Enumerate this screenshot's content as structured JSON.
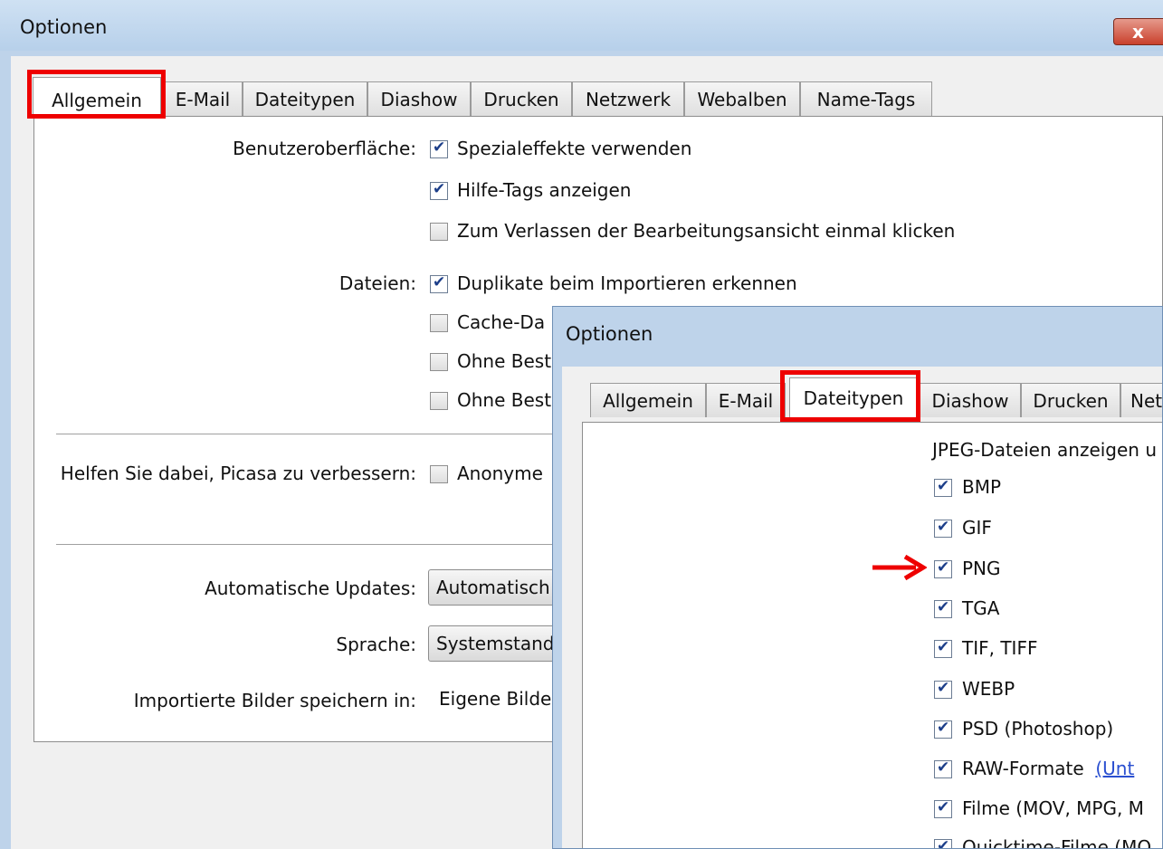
{
  "main": {
    "title": "Optionen",
    "close_glyph": "x",
    "tabs": [
      "Allgemein",
      "E-Mail",
      "Dateitypen",
      "Diashow",
      "Drucken",
      "Netzwerk",
      "Webalben",
      "Name-Tags"
    ],
    "active_tab": "Allgemein",
    "ui_label": "Benutzeroberfläche:",
    "ui_options": [
      {
        "label": "Spezialeffekte verwenden",
        "checked": true
      },
      {
        "label": "Hilfe-Tags anzeigen",
        "checked": true
      },
      {
        "label": "Zum Verlassen der Bearbeitungsansicht einmal klicken",
        "checked": false
      }
    ],
    "files_label": "Dateien:",
    "files_options": [
      {
        "label": "Duplikate beim Importieren erkennen",
        "checked": true
      },
      {
        "label": "Cache-Da",
        "checked": false
      },
      {
        "label": "Ohne Best",
        "checked": false
      },
      {
        "label": "Ohne Best",
        "checked": false
      }
    ],
    "help_label": "Helfen Sie dabei, Picasa zu verbessern:",
    "help_option": {
      "label": "Anonyme",
      "checked": false
    },
    "updates_label": "Automatische Updates:",
    "updates_value": "Automatisch",
    "language_label": "Sprache:",
    "language_value": "Systemstand",
    "import_label": "Importierte Bilder speichern in:",
    "import_value": "Eigene Bilde"
  },
  "overlay": {
    "title": "Optionen",
    "tabs": [
      "Allgemein",
      "E-Mail",
      "Dateitypen",
      "Diashow",
      "Drucken",
      "Net"
    ],
    "active_tab": "Dateitypen",
    "header": "JPEG-Dateien anzeigen u",
    "filetypes": [
      {
        "label": "BMP",
        "checked": true
      },
      {
        "label": "GIF",
        "checked": true
      },
      {
        "label": "PNG",
        "checked": true
      },
      {
        "label": "TGA",
        "checked": true
      },
      {
        "label": "TIF, TIFF",
        "checked": true
      },
      {
        "label": "WEBP",
        "checked": true
      },
      {
        "label": "PSD (Photoshop)",
        "checked": true
      },
      {
        "label": "RAW-Formate",
        "checked": true,
        "link": "(Unt"
      },
      {
        "label": "Filme (MOV, MPG, M",
        "checked": true
      },
      {
        "label": "Quicktime-Filme (MO",
        "checked": true
      }
    ]
  },
  "colors": {
    "highlight": "#ee0000",
    "link": "#2a4fd0",
    "titlebar": "#c3d8ef"
  }
}
